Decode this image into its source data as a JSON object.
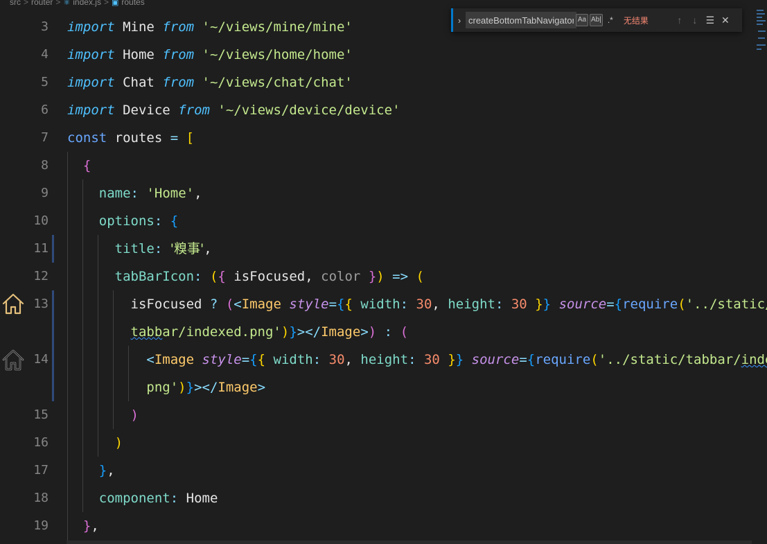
{
  "breadcrumb": {
    "items": [
      "src",
      "router",
      "index.js",
      "routes"
    ],
    "separator": ">"
  },
  "find": {
    "query": "createBottomTabNavigator",
    "match_case": "Aa",
    "whole_word": "Ab|",
    "regex": ".*",
    "result": "无结果"
  },
  "lines": [
    {
      "n": "3"
    },
    {
      "n": "4"
    },
    {
      "n": "5"
    },
    {
      "n": "6"
    },
    {
      "n": "7"
    },
    {
      "n": "8"
    },
    {
      "n": "9"
    },
    {
      "n": "10"
    },
    {
      "n": "11"
    },
    {
      "n": "12"
    },
    {
      "n": "13"
    },
    {
      "n": ""
    },
    {
      "n": "14"
    },
    {
      "n": ""
    },
    {
      "n": "15"
    },
    {
      "n": "16"
    },
    {
      "n": "17"
    },
    {
      "n": "18"
    },
    {
      "n": "19"
    }
  ],
  "tokens": {
    "import": "import",
    "from": "from",
    "mine_id": "Mine",
    "mine_path": "'~/views/mine/mine'",
    "home_id": "Home",
    "home_path": "'~/views/home/home'",
    "chat_id": "Chat",
    "chat_path": "'~/views/chat/chat'",
    "device_id": "Device",
    "device_path": "'~/views/device/device'",
    "const": "const",
    "routes": "routes",
    "name_key": "name",
    "name_val": "'Home'",
    "options_key": "options",
    "title_key": "title",
    "title_val": "'糗事'",
    "tabbaricon_key": "tabBarIcon",
    "isfocused": "isFocused",
    "color": "color",
    "image": "Image",
    "style": "style",
    "width": "width",
    "height": "height",
    "thirty": "30",
    "source": "source",
    "require": "require",
    "path13a": "'../static/",
    "path13b": "tabbar/indexed.png'",
    "path14a": "'../static/tabbar/index.",
    "path14b": "png'",
    "component_key": "component",
    "component_val": "Home"
  },
  "colors": {
    "background": "#1e1e1e",
    "keyword": "#4fc1ff",
    "string": "#c3e88d",
    "number": "#f78c6c",
    "tag": "#ffcb6b",
    "attribute": "#c792ea",
    "property": "#7fdbca",
    "find_no_result": "#f48771",
    "house_icon_active": "#e5c07b",
    "house_icon_inactive": "#d4d4d4"
  },
  "gutter_icons": [
    "house-icon-yellow",
    "house-icon-black"
  ]
}
